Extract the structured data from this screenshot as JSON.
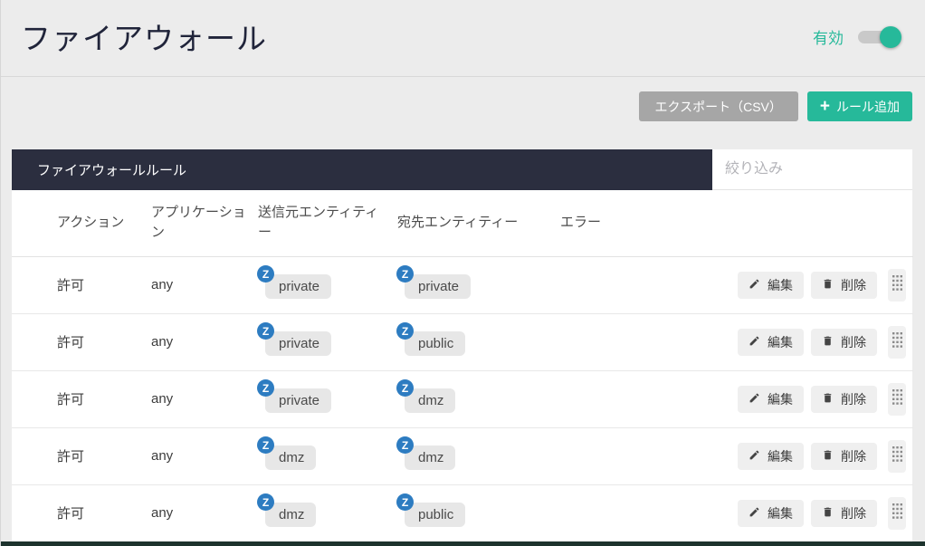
{
  "header": {
    "title": "ファイアウォール",
    "toggle_label": "有効",
    "toggle_state": "on"
  },
  "toolbar": {
    "export_label": "エクスポート（CSV）",
    "add_rule_plus": "+",
    "add_rule_label": "ルール追加"
  },
  "panel": {
    "title": "ファイアウォールルール",
    "filter_placeholder": "絞り込み"
  },
  "table": {
    "headers": {
      "action": "アクション",
      "application": "アプリケーション",
      "source": "送信元エンティティー",
      "destination": "宛先エンティティー",
      "error": "エラー"
    },
    "zone_badge_letter": "Z",
    "row_buttons": {
      "edit": "編集",
      "delete": "削除"
    },
    "rows": [
      {
        "action": "許可",
        "application": "any",
        "source": "private",
        "destination": "private",
        "error": ""
      },
      {
        "action": "許可",
        "application": "any",
        "source": "private",
        "destination": "public",
        "error": ""
      },
      {
        "action": "許可",
        "application": "any",
        "source": "private",
        "destination": "dmz",
        "error": ""
      },
      {
        "action": "許可",
        "application": "any",
        "source": "dmz",
        "destination": "dmz",
        "error": ""
      },
      {
        "action": "許可",
        "application": "any",
        "source": "dmz",
        "destination": "public",
        "error": ""
      }
    ]
  },
  "colors": {
    "accent_teal": "#26b99a",
    "header_bar_navy": "#2b2e3f",
    "zone_badge_blue": "#2d7cc1",
    "bottom_bar": "#1d332d"
  }
}
